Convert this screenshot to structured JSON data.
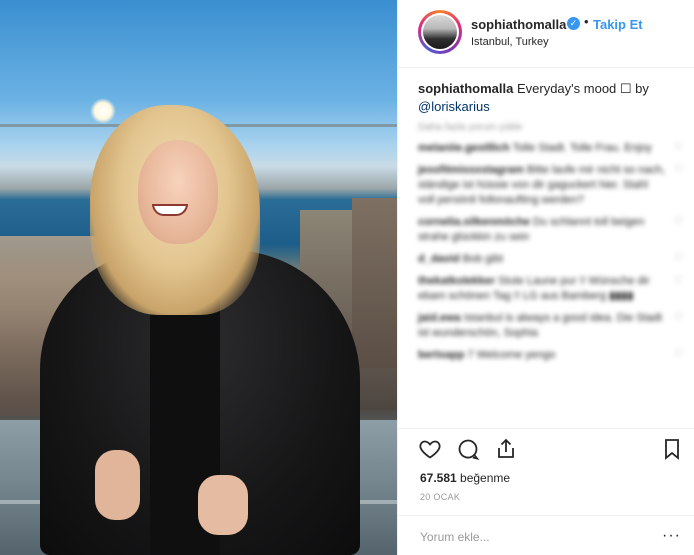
{
  "header": {
    "username": "sophiathomalla",
    "verified_mark": "✓",
    "separator": "•",
    "follow_label": "Takip Et",
    "location": "Istanbul, Turkey"
  },
  "caption": {
    "username": "sophiathomalla",
    "text": " Everyday's mood ☐ by",
    "mention": "@loriskarius"
  },
  "comments": {
    "more_label": "Daha fazla yorum yükle",
    "items": [
      {
        "user": "melaniie.gestllich",
        "text": "Tolle Stadt. Tolle Frau. Enjoy"
      },
      {
        "user": "jessfitmissxstagram",
        "text": "Bitte laufe mir nicht so nach, ständige ist hüssie von dir gaguckert hier. Stahl voll persönli follonaufting werden?"
      },
      {
        "user": "cornelia.silkenmöche",
        "text": "Du schlannt toll beigen strahe glückkin zu sein"
      },
      {
        "user": "d_david",
        "text": "Bob gibt"
      },
      {
        "user": "thekatkolekker",
        "text": "Stute Laune pur !! Wünsche dir ebam schönen Tag !! LG aus Bamberg ▮▮▮▮"
      },
      {
        "user": "jaid.ewa",
        "text": "Istanbul is always a good idea. Die Stadt ist wunderschön, Sophia"
      },
      {
        "user": "bertsapp",
        "text": "7 Welcome yengo"
      }
    ]
  },
  "actions": {
    "like_icon": "heart-icon",
    "comment_icon": "comment-icon",
    "share_icon": "share-icon",
    "save_icon": "bookmark-icon"
  },
  "likes": {
    "count": "67.581",
    "label": " beğenme"
  },
  "date": "20 OCAK",
  "comment_box": {
    "placeholder": "Yorum ekle...",
    "more": "···"
  },
  "colors": {
    "accent_blue": "#3897f0",
    "text": "#262626",
    "muted": "#999999",
    "border": "#efefef"
  }
}
